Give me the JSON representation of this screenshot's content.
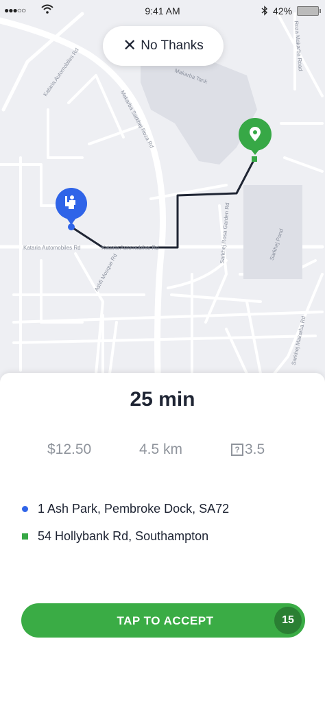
{
  "status_bar": {
    "signal": "●●●○○",
    "time": "9:41 AM",
    "battery": "42%",
    "icons": [
      "wifi-icon",
      "bluetooth-icon",
      "battery-icon"
    ]
  },
  "map": {
    "dismiss_label": "No Thanks",
    "dismiss_icon": "close-icon",
    "rider_icon": "rider-icon",
    "destination_icon": "location-pin-icon",
    "route_color": "#1f2533",
    "pickup_color": "#2f64e8",
    "dropoff_color": "#37a846",
    "road_labels": {
      "kataria_1": "Kataria Automobiles Rd",
      "makarba_road": "Makarba Sarkhej Roza Rd",
      "makarba_tank": "Makarba Tank",
      "roza_road": "Roza Makarba Road",
      "kataria_2": "Kataria Automobiles Rd",
      "kataria_3": "Kataria Automobiles Rd",
      "ashfi": "Ashfi Mosque Rd",
      "sarkhej_roza_garden": "Sarkhej Rosa Garden Rd",
      "sarkhej_pond": "Sarkhej Pond",
      "sarkhej_makarba": "Sarkhej Makarba Rd"
    }
  },
  "trip": {
    "duration": "25 min",
    "fare": "$12.50",
    "distance": "4.5 km",
    "rating_icon": "?",
    "rating": "3.5",
    "pickup": "1 Ash Park, Pembroke Dock, SA72",
    "dropoff": "54 Hollybank Rd, Southampton",
    "accept_label": "TAP TO ACCEPT",
    "countdown": "15"
  }
}
